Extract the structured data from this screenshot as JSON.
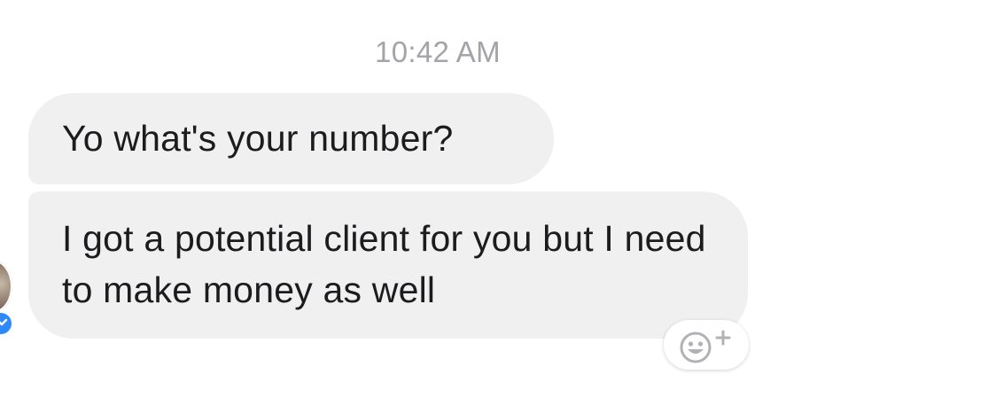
{
  "conversation": {
    "timestamp": "10:42 AM",
    "messages": [
      {
        "text": "Yo what's your number?"
      },
      {
        "text": "I got a potential client for you but I need to make money as well"
      }
    ]
  },
  "icons": {
    "reaction": "emoji-add-icon",
    "badge": "messenger-badge-icon"
  },
  "colors": {
    "bubble_background": "#f0f0f0",
    "timestamp": "#a3a3a8",
    "badge_blue": "#2e89ff"
  }
}
